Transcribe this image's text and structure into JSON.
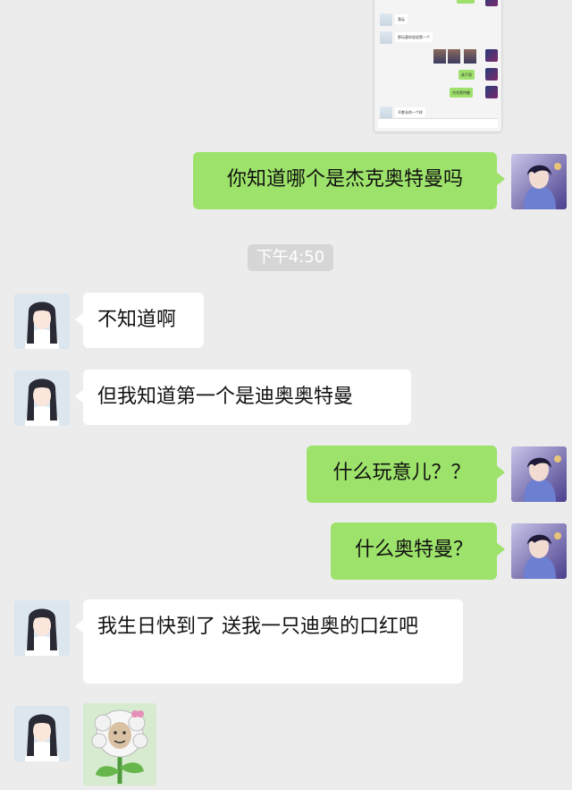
{
  "thumbnail": {
    "messages": [
      {
        "side": "left",
        "text": "我云"
      },
      {
        "side": "left",
        "text": "那玩意你说说第一个"
      },
      {
        "side": "right",
        "text": "谁干啥"
      },
      {
        "side": "right",
        "text": "杰克奥特曼"
      },
      {
        "side": "left",
        "text": "不都长的一个样"
      }
    ]
  },
  "chat": {
    "messages": [
      {
        "side": "right",
        "text": "你知道哪个是杰克奥特曼吗"
      },
      {
        "side": "left",
        "text": "不知道啊"
      },
      {
        "side": "left",
        "text": "但我知道第一个是迪奥奥特曼"
      },
      {
        "side": "right",
        "text": "什么玩意儿？？"
      },
      {
        "side": "right",
        "text": "什么奥特曼？"
      },
      {
        "side": "left",
        "text": "我生日快到了 送我一只迪奥的口红吧"
      }
    ],
    "timestamp": "下午4:50",
    "sticker": "flower-face-sticker"
  },
  "colors": {
    "background": "#ececec",
    "sent_bubble": "#9de26a",
    "received_bubble": "#ffffff",
    "timestamp_bg": "#d6d6d6"
  }
}
